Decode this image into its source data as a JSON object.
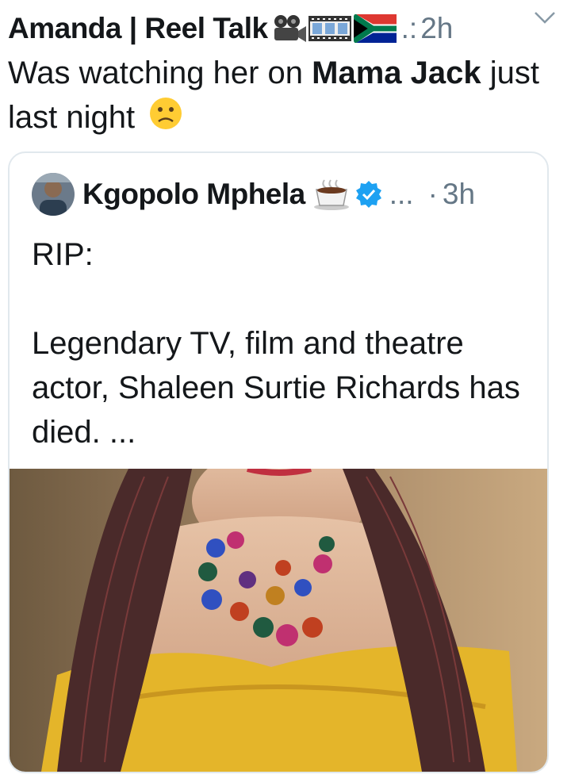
{
  "tweet": {
    "author_name": "Amanda | Reel Talk",
    "name_emojis": [
      "film-projector-icon",
      "film-frames-icon",
      "south-africa-flag-icon"
    ],
    "handle": ".:",
    "time": "2h",
    "text_part1": "Was watching her on ",
    "text_bold": "Mama Jack",
    "text_part2": " just last night"
  },
  "quote": {
    "author_name": "Kgopolo Mphela",
    "handle": "...",
    "separator": "·",
    "time": "3h",
    "line1": "RIP:",
    "line2": "Legendary TV, film and theatre actor, Shaleen Surtie Richards has died. ..."
  },
  "colors": {
    "secondary_text": "#657786",
    "verified_blue": "#1da1f2",
    "card_border": "#e1e8ed"
  }
}
